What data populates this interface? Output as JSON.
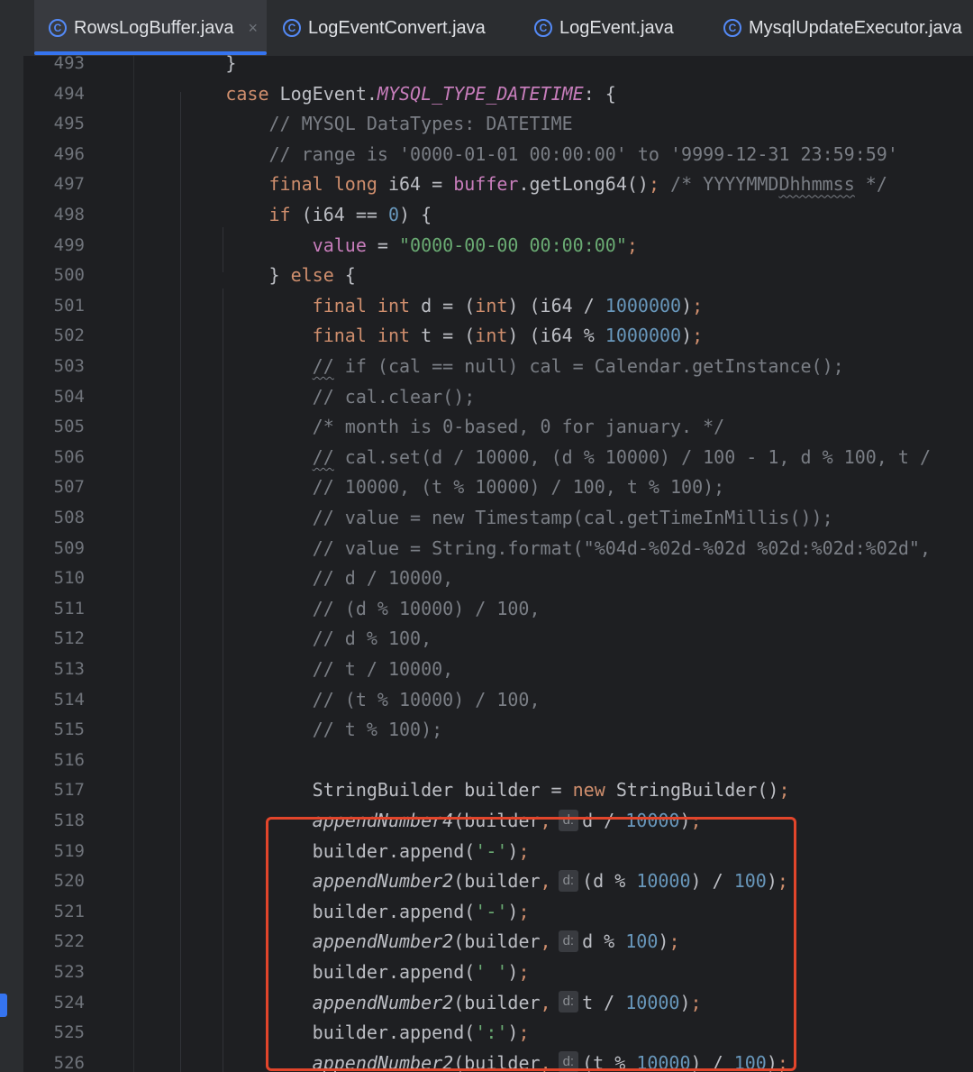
{
  "tabs": [
    {
      "label": "RowsLogBuffer.java",
      "icon": "java-class-icon",
      "active": true,
      "close": "×"
    },
    {
      "label": "LogEventConvert.java",
      "icon": "java-class-icon"
    },
    {
      "label": "LogEvent.java",
      "icon": "java-class-icon"
    },
    {
      "label": "MysqlUpdateExecutor.java",
      "icon": "java-class-icon"
    }
  ],
  "tab_icon_glyph": "C",
  "colors": {
    "accent": "#3574f0",
    "highlight_box": "#e2452b",
    "keyword": "#cf8e6d",
    "number": "#6897bb",
    "string": "#6aab73",
    "comment": "#7a7e85",
    "field": "#c77dbb"
  },
  "editor": {
    "lines": [
      {
        "n": "493",
        "t": [
          [
            "plain",
            "        }"
          ]
        ]
      },
      {
        "n": "494",
        "t": [
          [
            "kw",
            "        case "
          ],
          [
            "plain",
            "LogEvent."
          ],
          [
            "sfield",
            "MYSQL_TYPE_DATETIME"
          ],
          [
            "plain",
            ": {"
          ]
        ]
      },
      {
        "n": "495",
        "t": [
          [
            "cmt",
            "            // MYSQL DataTypes: DATETIME"
          ]
        ]
      },
      {
        "n": "496",
        "t": [
          [
            "cmt",
            "            // range is '0000-01-01 00:00:00' to '9999-12-31 23:59:59'"
          ]
        ]
      },
      {
        "n": "497",
        "t": [
          [
            "kw",
            "            final long "
          ],
          [
            "plain",
            "i64 = "
          ],
          [
            "field",
            "buffer"
          ],
          [
            "plain",
            ".getLong64()"
          ],
          [
            "kw",
            ";"
          ],
          [
            "cmt",
            " /* YYYYMMD"
          ],
          [
            "cmtw",
            "Dhhmmss"
          ],
          [
            "cmt",
            " */"
          ]
        ]
      },
      {
        "n": "498",
        "t": [
          [
            "kw",
            "            if "
          ],
          [
            "plain",
            "(i64 == "
          ],
          [
            "num",
            "0"
          ],
          [
            "plain",
            ") {"
          ]
        ]
      },
      {
        "n": "499",
        "t": [
          [
            "field",
            "                value"
          ],
          [
            "plain",
            " = "
          ],
          [
            "str",
            "\"0000-00-00 00:00:00\""
          ],
          [
            "kw",
            ";"
          ]
        ]
      },
      {
        "n": "500",
        "t": [
          [
            "plain",
            "            } "
          ],
          [
            "kw",
            "else "
          ],
          [
            "plain",
            "{"
          ]
        ]
      },
      {
        "n": "501",
        "t": [
          [
            "kw",
            "                final int "
          ],
          [
            "plain",
            "d = ("
          ],
          [
            "kw",
            "int"
          ],
          [
            "plain",
            ") (i64 / "
          ],
          [
            "num",
            "1000000"
          ],
          [
            "plain",
            ")"
          ],
          [
            "kw",
            ";"
          ]
        ]
      },
      {
        "n": "502",
        "t": [
          [
            "kw",
            "                final int "
          ],
          [
            "plain",
            "t = ("
          ],
          [
            "kw",
            "int"
          ],
          [
            "plain",
            ") (i64 % "
          ],
          [
            "num",
            "1000000"
          ],
          [
            "plain",
            ")"
          ],
          [
            "kw",
            ";"
          ]
        ]
      },
      {
        "n": "503",
        "t": [
          [
            "cmt",
            "                "
          ],
          [
            "cmtw",
            "//"
          ],
          [
            "cmt",
            " if (cal == null) cal = Calendar.getInstance();"
          ]
        ]
      },
      {
        "n": "504",
        "t": [
          [
            "cmt",
            "                // cal.clear();"
          ]
        ]
      },
      {
        "n": "505",
        "t": [
          [
            "cmt",
            "                /* month is 0-based, 0 for january. */"
          ]
        ]
      },
      {
        "n": "506",
        "t": [
          [
            "cmt",
            "                "
          ],
          [
            "cmtw",
            "//"
          ],
          [
            "cmt",
            " cal.set(d / 10000, (d % 10000) / 100 - 1, d % 100, t /"
          ]
        ]
      },
      {
        "n": "507",
        "t": [
          [
            "cmt",
            "                // 10000, (t % 10000) / 100, t % 100);"
          ]
        ]
      },
      {
        "n": "508",
        "t": [
          [
            "cmt",
            "                // value = new Timestamp(cal.getTimeInMillis());"
          ]
        ]
      },
      {
        "n": "509",
        "t": [
          [
            "cmt",
            "                // value = String.format(\"%04d-%02d-%02d %02d:%02d:%02d\","
          ]
        ]
      },
      {
        "n": "510",
        "t": [
          [
            "cmt",
            "                // d / 10000,"
          ]
        ]
      },
      {
        "n": "511",
        "t": [
          [
            "cmt",
            "                // (d % 10000) / 100,"
          ]
        ]
      },
      {
        "n": "512",
        "t": [
          [
            "cmt",
            "                // d % 100,"
          ]
        ]
      },
      {
        "n": "513",
        "t": [
          [
            "cmt",
            "                // t / 10000,"
          ]
        ]
      },
      {
        "n": "514",
        "t": [
          [
            "cmt",
            "                // (t % 10000) / 100,"
          ]
        ]
      },
      {
        "n": "515",
        "t": [
          [
            "cmt",
            "                // t % 100);"
          ]
        ]
      },
      {
        "n": "516",
        "t": []
      },
      {
        "n": "517",
        "t": [
          [
            "plain",
            "                StringBuilder builder = "
          ],
          [
            "kw",
            "new "
          ],
          [
            "plain",
            "StringBuilder()"
          ],
          [
            "kw",
            ";"
          ]
        ]
      },
      {
        "n": "518",
        "t": [
          [
            "mstatic",
            "                appendNumber4"
          ],
          [
            "plain",
            "(builder"
          ],
          [
            "kw",
            ","
          ],
          [
            "hint",
            "d:"
          ],
          [
            "plain",
            "d / "
          ],
          [
            "num",
            "10000"
          ],
          [
            "plain",
            ")"
          ],
          [
            "kw",
            ";"
          ]
        ]
      },
      {
        "n": "519",
        "t": [
          [
            "plain",
            "                builder.append("
          ],
          [
            "str",
            "'-'"
          ],
          [
            "plain",
            ")"
          ],
          [
            "kw",
            ";"
          ]
        ]
      },
      {
        "n": "520",
        "t": [
          [
            "mstatic",
            "                appendNumber2"
          ],
          [
            "plain",
            "(builder"
          ],
          [
            "kw",
            ","
          ],
          [
            "hint",
            "d:"
          ],
          [
            "plain",
            "(d % "
          ],
          [
            "num",
            "10000"
          ],
          [
            "plain",
            ") / "
          ],
          [
            "num",
            "100"
          ],
          [
            "plain",
            ")"
          ],
          [
            "kw",
            ";"
          ]
        ]
      },
      {
        "n": "521",
        "t": [
          [
            "plain",
            "                builder.append("
          ],
          [
            "str",
            "'-'"
          ],
          [
            "plain",
            ")"
          ],
          [
            "kw",
            ";"
          ]
        ]
      },
      {
        "n": "522",
        "t": [
          [
            "mstatic",
            "                appendNumber2"
          ],
          [
            "plain",
            "(builder"
          ],
          [
            "kw",
            ","
          ],
          [
            "hint",
            "d:"
          ],
          [
            "plain",
            "d % "
          ],
          [
            "num",
            "100"
          ],
          [
            "plain",
            ")"
          ],
          [
            "kw",
            ";"
          ]
        ]
      },
      {
        "n": "523",
        "t": [
          [
            "plain",
            "                builder.append("
          ],
          [
            "str",
            "' '"
          ],
          [
            "plain",
            ")"
          ],
          [
            "kw",
            ";"
          ]
        ]
      },
      {
        "n": "524",
        "t": [
          [
            "mstatic",
            "                appendNumber2"
          ],
          [
            "plain",
            "(builder"
          ],
          [
            "kw",
            ","
          ],
          [
            "hint",
            "d:"
          ],
          [
            "plain",
            "t / "
          ],
          [
            "num",
            "10000"
          ],
          [
            "plain",
            ")"
          ],
          [
            "kw",
            ";"
          ]
        ]
      },
      {
        "n": "525",
        "t": [
          [
            "plain",
            "                builder.append("
          ],
          [
            "str",
            "':'"
          ],
          [
            "plain",
            ")"
          ],
          [
            "kw",
            ";"
          ]
        ]
      },
      {
        "n": "526",
        "t": [
          [
            "mstatic",
            "                appendNumber2"
          ],
          [
            "plain",
            "(builder"
          ],
          [
            "kw",
            ","
          ],
          [
            "hint",
            "d:"
          ],
          [
            "plain",
            "(t % "
          ],
          [
            "num",
            "10000"
          ],
          [
            "plain",
            ") / "
          ],
          [
            "num",
            "100"
          ],
          [
            "plain",
            ")"
          ],
          [
            "kw",
            ";"
          ]
        ]
      }
    ]
  }
}
